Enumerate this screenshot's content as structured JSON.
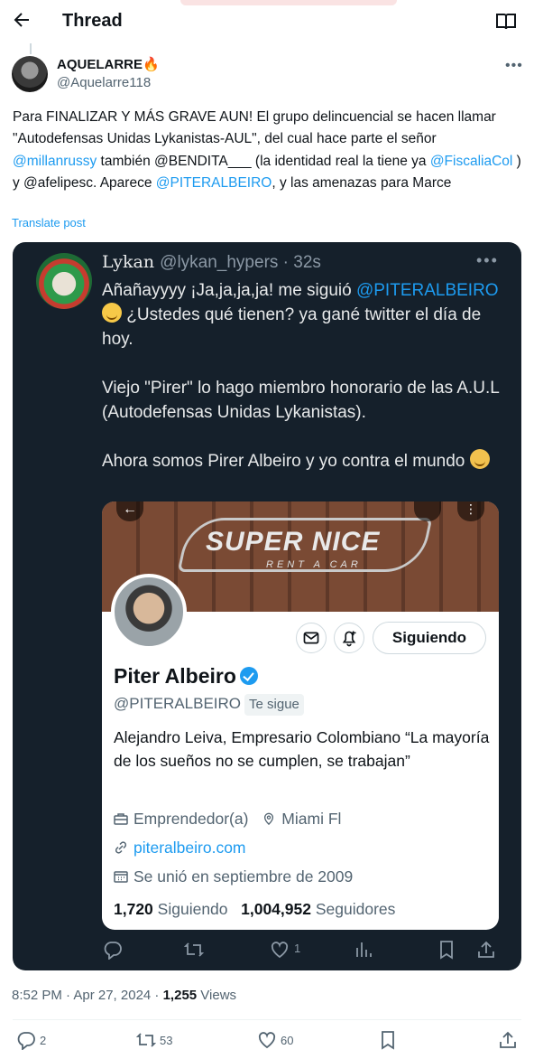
{
  "header": {
    "title": "Thread"
  },
  "post": {
    "author_name": "AQUELARRE🔥",
    "author_handle": "@Aquelarre118",
    "text_parts": [
      "Para FINALIZAR Y MÁS GRAVE AUN! El grupo delincuencial se hacen llamar \"Autodefensas Unidas Lykanistas-AUL\", del cual hace parte el señor ",
      "@millanrussy",
      " también @BENDITA___ (la identidad real la tiene ya ",
      "@FiscaliaCol",
      " ) y @afelipesc. Aparece ",
      "@PITERALBEIRO",
      ", y las amenazas para Marce"
    ],
    "translate": "Translate post",
    "time": "8:52 PM · Apr 27, 2024 · ",
    "views_count": "1,255",
    "views_label": " Views",
    "replies": "2",
    "reposts": "53",
    "likes": "60"
  },
  "embed": {
    "name": "Lykan",
    "handle": "@lykan_hypers · 32s",
    "line1": "Añañayyyy ¡Ja,ja,ja,ja! me siguió",
    "mention": "@PITERALBEIRO",
    "line2": " ¿Ustedes qué tienen? ya gané twitter el día de hoy.",
    "para2": "Viejo \"Pirer\" lo hago miembro honorario de las A.U.L (Autodefensas Unidas Lykanistas).",
    "para3": "Ahora somos Pirer Albeiro y yo contra el mundo",
    "likes": "1",
    "card": {
      "banner_text": "SUPER NICE",
      "banner_sub": "RENT A CAR",
      "follow_label": "Siguiendo",
      "name": "Piter Albeiro",
      "handle": "@PITERALBEIRO",
      "follows_you": "Te sigue",
      "bio": "Alejandro Leiva, Empresario Colombiano “La mayoría de los sueños no se cumplen, se trabajan”",
      "job": "Emprendedor(a)",
      "location": "Miami Fl",
      "website": "piteralbeiro.com",
      "joined": "Se unió en septiembre de 2009",
      "following_count": "1,720",
      "following_label": "Siguiendo",
      "followers_count": "1,004,952",
      "followers_label": "Seguidores"
    }
  }
}
